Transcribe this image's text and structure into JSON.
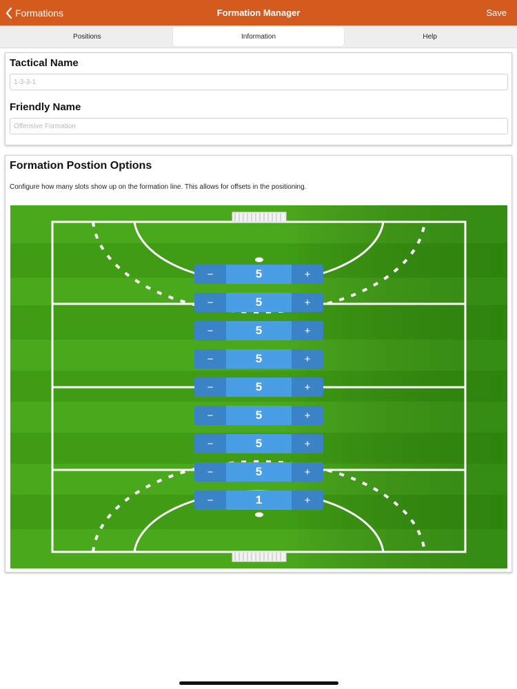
{
  "navbar": {
    "back_label": "Formations",
    "title": "Formation Manager",
    "save_label": "Save",
    "background_color": "#d45a1e"
  },
  "tabs": [
    {
      "label": "Positions",
      "active": false
    },
    {
      "label": "Information",
      "active": true
    },
    {
      "label": "Help",
      "active": false
    }
  ],
  "info": {
    "tactical_name_label": "Tactical Name",
    "tactical_name_value": "",
    "tactical_name_placeholder": "1-3-3-1",
    "friendly_name_label": "Friendly Name",
    "friendly_name_value": "",
    "friendly_name_placeholder": "Offensive Formation"
  },
  "formation_options": {
    "title": "Formation Postion Options",
    "description": "Configure how many slots show up on the formation line.  This allows for offsets in the positioning.",
    "steppers": [
      {
        "minus": "−",
        "value": "5",
        "plus": "+"
      },
      {
        "minus": "−",
        "value": "5",
        "plus": "+"
      },
      {
        "minus": "−",
        "value": "5",
        "plus": "+"
      },
      {
        "minus": "−",
        "value": "5",
        "plus": "+"
      },
      {
        "minus": "−",
        "value": "5",
        "plus": "+"
      },
      {
        "minus": "−",
        "value": "5",
        "plus": "+"
      },
      {
        "minus": "−",
        "value": "5",
        "plus": "+"
      },
      {
        "minus": "−",
        "value": "5",
        "plus": "+"
      },
      {
        "minus": "−",
        "value": "1",
        "plus": "+"
      }
    ]
  },
  "colors": {
    "field_green": "#4aa81c",
    "stepper_button": "#3a83c6",
    "stepper_value": "#4a9ee4"
  }
}
